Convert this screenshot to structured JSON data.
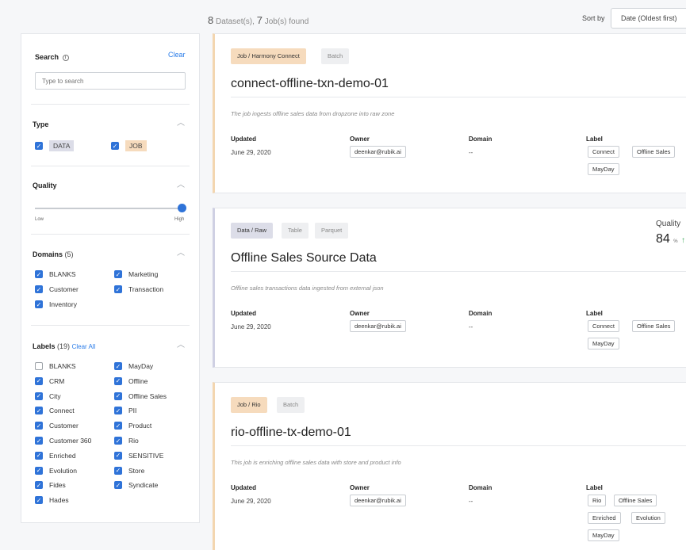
{
  "header": {
    "datasets_count": "8",
    "datasets_label": "Dataset(s),",
    "jobs_count": "7",
    "jobs_label": "Job(s) found",
    "sort_label": "Sort by",
    "sort_value": "Date (Oldest first)"
  },
  "sidebar": {
    "search": {
      "title": "Search",
      "clear": "Clear",
      "placeholder": "Type to search"
    },
    "type": {
      "title": "Type",
      "options": [
        {
          "label": "DATA",
          "checked": true
        },
        {
          "label": "JOB",
          "checked": true
        }
      ]
    },
    "quality": {
      "title": "Quality",
      "low": "Low",
      "high": "High",
      "level": 1.0
    },
    "domains": {
      "title": "Domains",
      "count": "(5)",
      "options": [
        {
          "label": "BLANKS",
          "checked": true
        },
        {
          "label": "Marketing",
          "checked": true
        },
        {
          "label": "Customer",
          "checked": true
        },
        {
          "label": "Transaction",
          "checked": true
        },
        {
          "label": "Inventory",
          "checked": true
        }
      ]
    },
    "labels": {
      "title": "Labels",
      "count": "(19)",
      "clear_all": "Clear All",
      "left": [
        {
          "label": "BLANKS",
          "checked": false
        },
        {
          "label": "CRM",
          "checked": true
        },
        {
          "label": "City",
          "checked": true
        },
        {
          "label": "Connect",
          "checked": true
        },
        {
          "label": "Customer",
          "checked": true
        },
        {
          "label": "Customer 360",
          "checked": true
        },
        {
          "label": "Enriched",
          "checked": true
        },
        {
          "label": "Evolution",
          "checked": true
        },
        {
          "label": "Fides",
          "checked": true
        },
        {
          "label": "Hades",
          "checked": true
        }
      ],
      "right": [
        {
          "label": "MayDay",
          "checked": true
        },
        {
          "label": "Offline",
          "checked": true
        },
        {
          "label": "Offline Sales",
          "checked": true
        },
        {
          "label": "PII",
          "checked": true
        },
        {
          "label": "Product",
          "checked": true
        },
        {
          "label": "Rio",
          "checked": true
        },
        {
          "label": "SENSITIVE",
          "checked": true
        },
        {
          "label": "Store",
          "checked": true
        },
        {
          "label": "Syndicate",
          "checked": true
        }
      ]
    }
  },
  "cards": [
    {
      "kind": "job",
      "tags": [
        "Job / Harmony Connect",
        "Batch"
      ],
      "title": "connect-offline-txn-demo-01",
      "description": "The job ingests offline sales data from dropzone into raw zone",
      "updated_h": "Updated",
      "updated": "June 29, 2020",
      "owner_h": "Owner",
      "owner": "deenkar@rubik.ai",
      "domain_h": "Domain",
      "domain": "--",
      "label_h": "Label",
      "labels": [
        "Connect",
        "Offline Sales",
        "MayDay"
      ]
    },
    {
      "kind": "data",
      "tags": [
        "Data / Raw",
        "Table",
        "Parquet"
      ],
      "title": "Offline Sales Source Data",
      "description": "Offline sales transactions data ingested from external json",
      "quality_label": "Quality",
      "quality_value": "84",
      "quality_unit": "%",
      "updated_h": "Updated",
      "updated": "June 29, 2020",
      "owner_h": "Owner",
      "owner": "deenkar@rubik.ai",
      "domain_h": "Domain",
      "domain": "--",
      "label_h": "Label",
      "labels": [
        "Connect",
        "Offline Sales",
        "MayDay"
      ]
    },
    {
      "kind": "job",
      "tags": [
        "Job / Rio",
        "Batch"
      ],
      "title": "rio-offline-tx-demo-01",
      "description": "This job is enriching offline sales data with store and product info",
      "updated_h": "Updated",
      "updated": "June 29, 2020",
      "owner_h": "Owner",
      "owner": "deenkar@rubik.ai",
      "domain_h": "Domain",
      "domain": "--",
      "label_h": "Label",
      "labels": [
        "Rio",
        "Offline Sales",
        "Enriched",
        "Evolution",
        "MayDay"
      ]
    }
  ]
}
